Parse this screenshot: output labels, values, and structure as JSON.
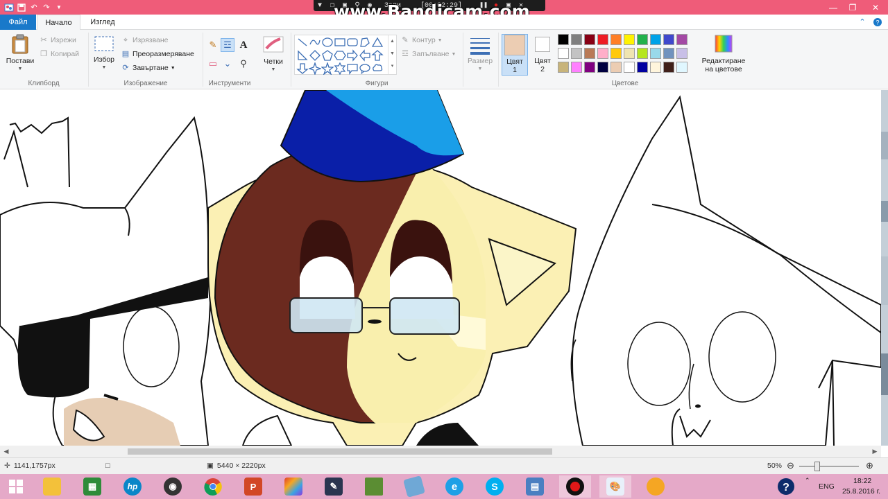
{
  "recording": {
    "watermark": "www.Bandicam.com",
    "status": "Запи",
    "timer": "[00:02:29]"
  },
  "tabs": {
    "file": "Файл",
    "home": "Начало",
    "view": "Изглед"
  },
  "clipboard": {
    "paste": "Постави",
    "cut": "Изрежи",
    "copy": "Копирай",
    "label": "Клипборд"
  },
  "image": {
    "select": "Избор",
    "crop": "Изрязване",
    "resize": "Преоразмеряване",
    "rotate": "Завъртане",
    "label": "Изображение"
  },
  "tools": {
    "label": "Инструменти",
    "brushes": "Четки"
  },
  "shapes": {
    "outline": "Контур",
    "fill": "Запълване",
    "label": "Фигури"
  },
  "size": {
    "label": "Размер"
  },
  "colors": {
    "color1_line1": "Цвят",
    "color1_line2": "1",
    "color2_line1": "Цвят",
    "color2_line2": "2",
    "edit_line1": "Редактиране",
    "edit_line2": "на цветове",
    "label": "Цветове",
    "color1_value": "#eccdb3",
    "color2_value": "#ffffff",
    "palette_row1": [
      "#000000",
      "#7f7f7f",
      "#880015",
      "#ed1c24",
      "#ff7f27",
      "#fff200",
      "#22b14c",
      "#00a2e8",
      "#3f48cc",
      "#a349a4"
    ],
    "palette_row2": [
      "#ffffff",
      "#c3c3c3",
      "#b97a57",
      "#ffaec9",
      "#ffc90e",
      "#efe4b0",
      "#b5e61d",
      "#99d9ea",
      "#7092be",
      "#c8bfe7"
    ],
    "palette_row3": [
      "#c8b47a",
      "#ff80ff",
      "#800080",
      "#000040",
      "#eccdb3",
      "#ffffff",
      "#0000a0",
      "#fff5dc",
      "#40201a",
      "#e0f7ff"
    ]
  },
  "status": {
    "cursor_pos": "1141,1757px",
    "image_size": "5440 × 2220px",
    "zoom": "50%"
  },
  "taskbar": {
    "language": "ENG",
    "time": "18:22",
    "date": "25.8.2016 г."
  }
}
